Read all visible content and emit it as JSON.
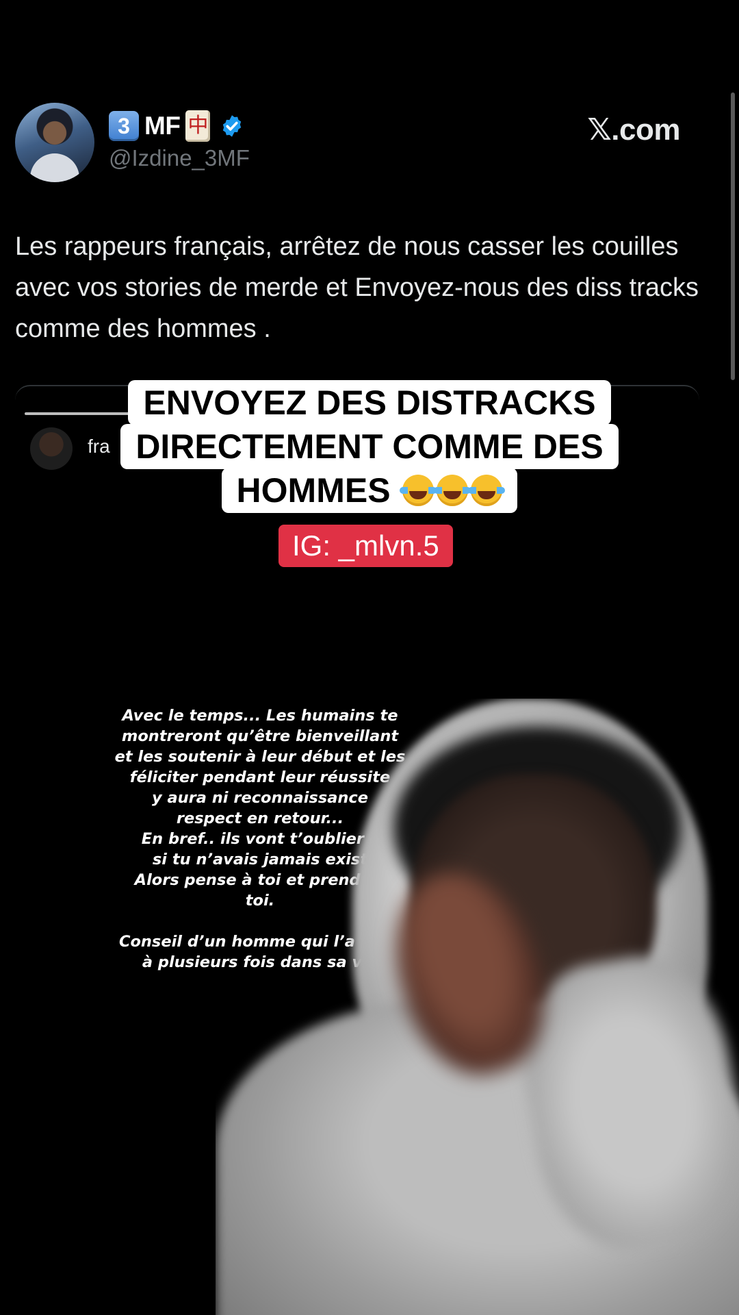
{
  "tweet": {
    "badge_digit": "3",
    "name_text": "MF",
    "mahjong_glyph": "中",
    "handle": "@Izdine_3MF",
    "site_label": "𝕏.com",
    "text": "Les rappeurs français, arrêtez de nous casser les couilles avec vos stories de merde et Envoyez-nous des diss tracks comme des hommes .",
    "quoted_name": "fra",
    "verified_color": "#1d9bf0"
  },
  "caption": {
    "line1": "ENVOYEZ DES DISTRACKS",
    "line2": "DIRECTEMENT COMME DES",
    "line3": "HOMMES",
    "emoji_icon": "face-with-tears-of-joy",
    "ig_tag": "IG: _mlvn.5",
    "ig_color": "#e03145"
  },
  "story": {
    "text": "Avec le temps... Les humains te\nmontreront qu’être bienveillant\net les soutenir à leur début et les\nféliciter pendant leur réussite\ny aura ni reconnaissance\nrespect en retour...\nEn bref.. ils vont t’oublier c\nsi tu n’avais jamais exist\nAlors pense à toi et prend so\ntoi.\n\nConseil d’un homme qui l’a vécu\nà plusieurs fois dans sa vie"
  }
}
